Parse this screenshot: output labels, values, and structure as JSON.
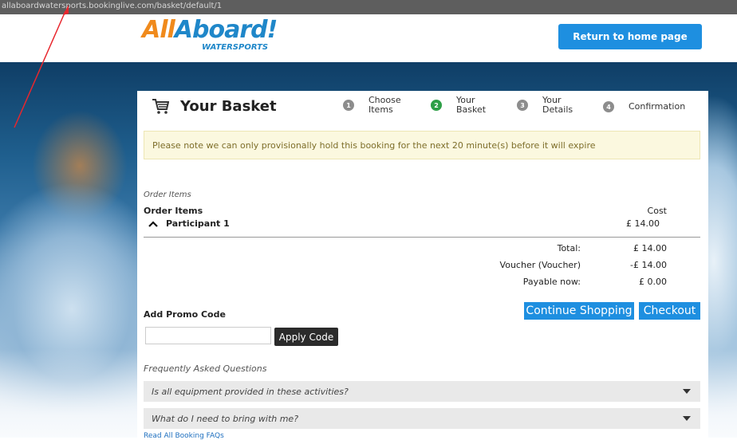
{
  "browser": {
    "url": "allaboardwatersports.bookinglive.com/basket/default/1"
  },
  "header": {
    "logo_text_1": "All",
    "logo_text_2": "Aboard!",
    "logo_sub": "WATERSPORTS",
    "home_button": "Return to home page"
  },
  "basket": {
    "title": "Your Basket",
    "steps": [
      {
        "num": "1",
        "label": "Choose\nItems"
      },
      {
        "num": "2",
        "label": "Your\nBasket"
      },
      {
        "num": "3",
        "label": "Your\nDetails"
      },
      {
        "num": "4",
        "label": "Confirmation"
      }
    ],
    "notice": "Please note we can only provisionally hold this booking for the next 20 minute(s) before it will expire",
    "order_heading": "Order Items",
    "order_title": "Order Items",
    "cost_header": "Cost",
    "participant": "Participant 1",
    "participant_cost": "£ 14.00",
    "totals": [
      {
        "label": "Total:",
        "value": "£ 14.00"
      },
      {
        "label": "Voucher (Voucher)",
        "value": "-£ 14.00"
      },
      {
        "label": "Payable now:",
        "value": "£ 0.00"
      }
    ],
    "promo_label": "Add Promo Code",
    "promo_value": "",
    "apply_button": "Apply Code",
    "continue_button": "Continue Shopping",
    "checkout_button": "Checkout",
    "faq_heading": "Frequently Asked Questions",
    "faqs": [
      "Is all equipment provided in these activities?",
      "What do I need to bring with me?"
    ],
    "faq_link": "Read All Booking FAQs"
  },
  "colors": {
    "accent": "#1e8fe0",
    "active_step": "#2e9f47",
    "arrow": "#e8262d"
  }
}
